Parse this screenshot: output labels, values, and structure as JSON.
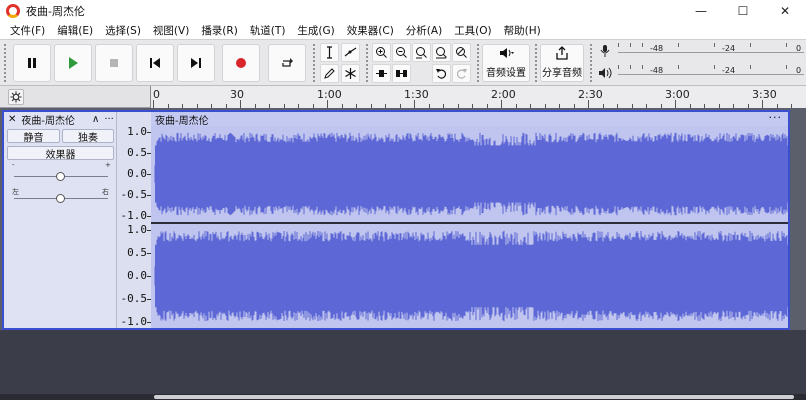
{
  "window": {
    "title": "夜曲-周杰伦",
    "minimize": "—",
    "maximize": "☐",
    "close": "✕"
  },
  "menu": [
    "文件(F)",
    "编辑(E)",
    "选择(S)",
    "视图(V)",
    "播录(R)",
    "轨道(T)",
    "生成(G)",
    "效果器(C)",
    "分析(A)",
    "工具(O)",
    "帮助(H)"
  ],
  "toolbar": {
    "pause": "pause-icon",
    "play": "play-icon",
    "stop": "stop-icon",
    "skip_start": "skip-start-icon",
    "skip_end": "skip-end-icon",
    "record": "record-icon",
    "loop": "loop-icon",
    "audio_setup_label": "音频设置",
    "share_audio_label": "分享音频",
    "meter_scale_1": "-48",
    "meter_scale_2": "-24",
    "meter_scale_3": "0",
    "accent_record": "#d9262b",
    "accent_play": "#2e9a3a"
  },
  "timeline": {
    "labels": [
      "0",
      "30",
      "1:00",
      "1:30",
      "2:00",
      "2:30",
      "3:00",
      "3:30"
    ]
  },
  "track": {
    "close": "✕",
    "name": "夜曲-周杰伦",
    "collapse": "∧",
    "more": "···",
    "mute_label": "静音",
    "solo_label": "独奏",
    "effects_label": "效果器",
    "gain_minus": "-",
    "gain_plus": "+",
    "pan_left": "左",
    "pan_right": "右",
    "gain_value": 0.5,
    "pan_value": 0.5
  },
  "clip": {
    "name": "夜曲-周杰伦",
    "more": "···",
    "wave_color": "#5d68d6",
    "bg_color": "#bfc5ee"
  },
  "amplitude_scale": [
    "1.0",
    "0.5",
    "0.0",
    "-0.5",
    "-1.0"
  ]
}
